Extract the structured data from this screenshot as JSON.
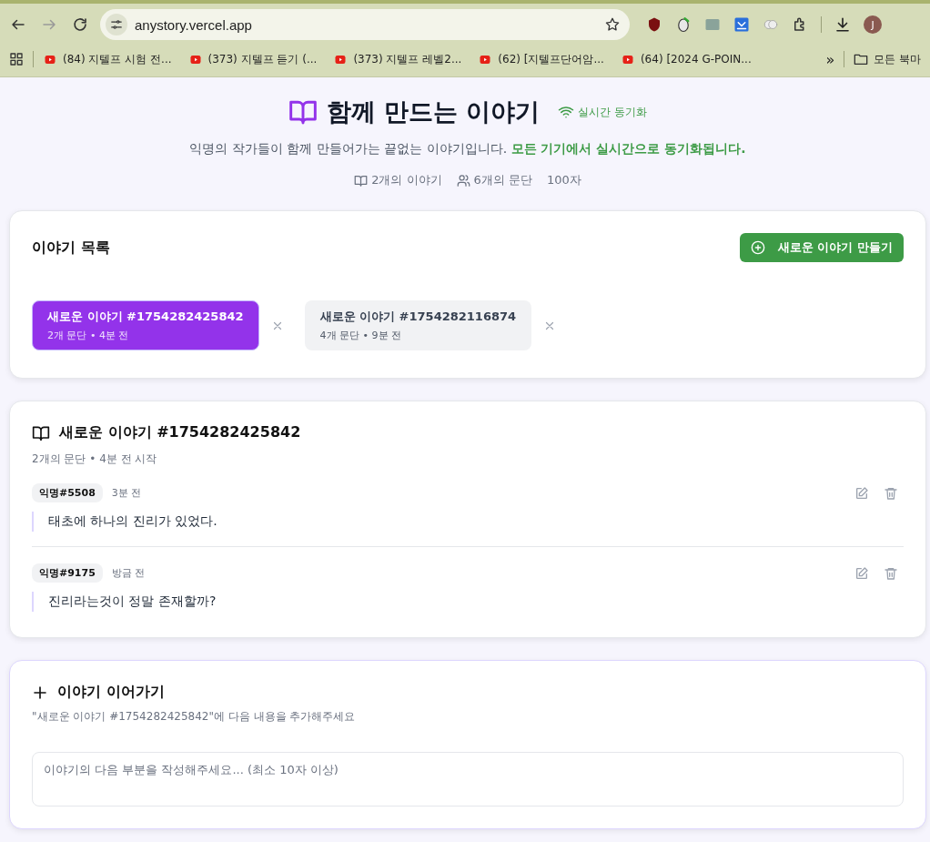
{
  "browser": {
    "url": "anystory.vercel.app",
    "profile_initial": "J",
    "bookmarks": [
      {
        "label": "(84) 지텔프 시험 전..."
      },
      {
        "label": "(373) 지텔프 듣기 (..."
      },
      {
        "label": "(373) 지텔프 레벨2..."
      },
      {
        "label": "(62) [지텔프단어암..."
      },
      {
        "label": "(64) [2024 G-POIN..."
      }
    ],
    "more": "»",
    "folder": "모든 북마"
  },
  "header": {
    "title": "함께 만드는 이야기",
    "sync": "실시간 동기화",
    "intro": "익명의 작가들이 함께 만들어가는 끝없는 이야기입니다. **모든 기기에서 실시간으로 동기화됩니다.**",
    "stats": [
      {
        "kind": "book",
        "text": "2개의 이야기"
      },
      {
        "kind": "users",
        "text": "6개의 문단"
      },
      {
        "kind": "plain",
        "text": "100자"
      }
    ]
  },
  "story_list": {
    "title": "이야기 목록",
    "create_button": "새로운 이야기 만들기",
    "stories": [
      {
        "title": "새로운 이야기 #1754282425842",
        "meta": "2개 문단 • 4분 전",
        "selected": true
      },
      {
        "title": "새로운 이야기 #1754282116874",
        "meta": "4개 문단 • 9분 전",
        "selected": false
      }
    ]
  },
  "story": {
    "title": "새로운 이야기 #1754282425842",
    "meta": "2개의 문단 • 4분 전 시작",
    "paragraphs": [
      {
        "author": "익명#5508",
        "time": "3분 전",
        "text": "태초에 하나의 진리가 있었다."
      },
      {
        "author": "익명#9175",
        "time": "방금 전",
        "text": "진리라는것이 정말 존재할까?"
      }
    ]
  },
  "continue": {
    "title": "이야기 이어가기",
    "hint": "\"새로운 이야기 #1754282425842\"에 다음 내용을 추가해주세요",
    "placeholder": "이야기의 다음 부분을 작성해주세요... (최소 10자 이상)"
  }
}
